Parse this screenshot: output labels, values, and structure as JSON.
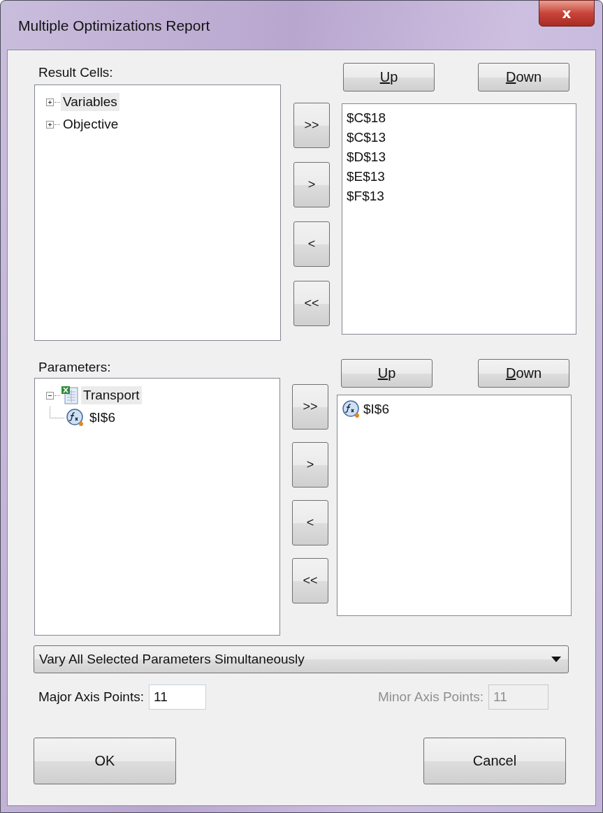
{
  "window": {
    "title": "Multiple Optimizations Report",
    "close": "x"
  },
  "result_cells": {
    "label": "Result Cells:",
    "tree": [
      {
        "label": "Variables",
        "expanded": false,
        "selected": true
      },
      {
        "label": "Objective",
        "expanded": false,
        "selected": false
      }
    ],
    "move_buttons": [
      ">>",
      ">",
      "<",
      "<<"
    ],
    "order_buttons": [
      {
        "access_key": "U",
        "label_rest": "p"
      },
      {
        "access_key": "D",
        "label_rest": "own"
      }
    ],
    "selected_list": [
      "$C$18",
      "$C$13",
      "$D$13",
      "$E$13",
      "$F$13"
    ]
  },
  "parameters": {
    "label": "Parameters:",
    "tree": [
      {
        "label": "Transport",
        "kind": "workbook",
        "expanded": true,
        "selected": true,
        "children": [
          {
            "label": "$I$6",
            "kind": "formula",
            "selected": false
          }
        ]
      }
    ],
    "move_buttons": [
      ">>",
      ">",
      "<",
      "<<"
    ],
    "order_buttons": [
      {
        "access_key": "U",
        "label_rest": "p"
      },
      {
        "access_key": "D",
        "label_rest": "own"
      }
    ],
    "selected_list": [
      "$I$6"
    ]
  },
  "mode_dropdown": {
    "value": "Vary All Selected Parameters Simultaneously"
  },
  "major_axis": {
    "label": "Major Axis Points:",
    "value": "11",
    "disabled": false
  },
  "minor_axis": {
    "label": "Minor Axis Points:",
    "value": "11",
    "disabled": true
  },
  "buttons": [
    "OK",
    "Cancel"
  ]
}
